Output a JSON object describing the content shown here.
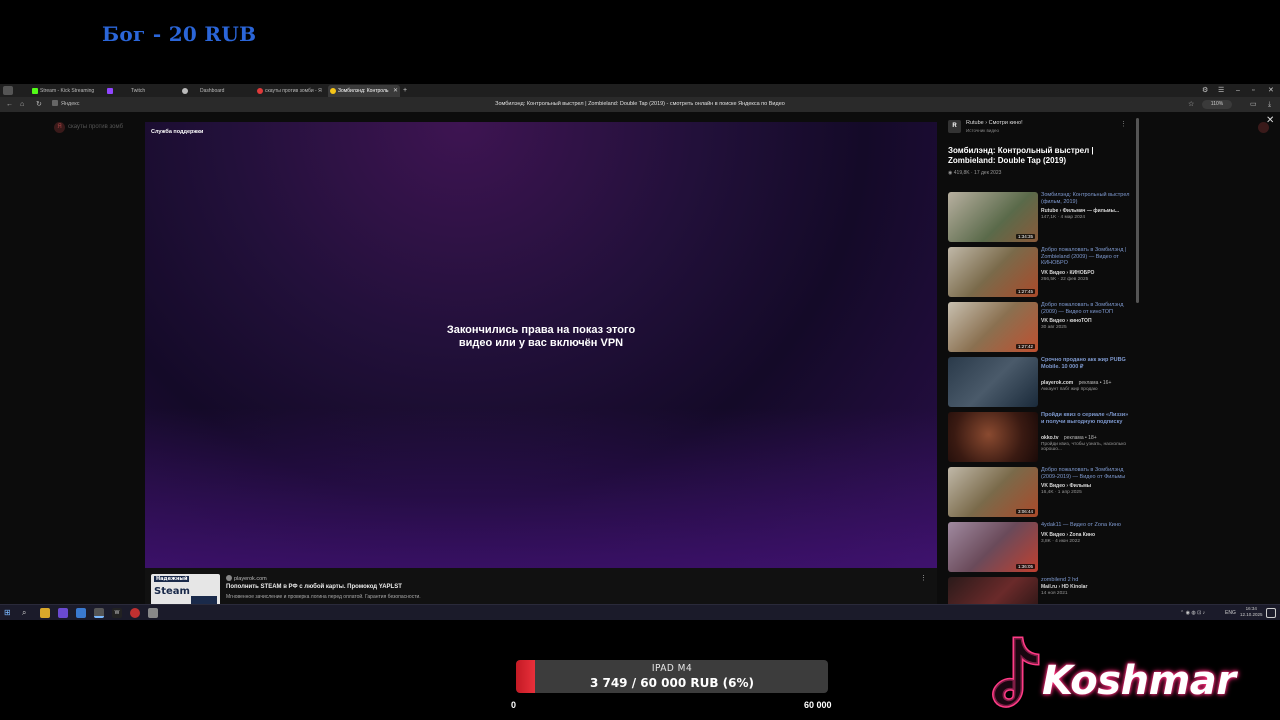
{
  "overlay": {
    "donor_label": "Бог - 20 RUB",
    "goal": {
      "name": "IPAD M4",
      "amount_text": "3 749 / 60 000 RUB (6%)",
      "current": 3749,
      "target": 60000,
      "progress": 0.06,
      "min_label": "0",
      "max_label": "60 000",
      "fill_color": "#e0232e"
    },
    "logo_text": "Koshmar"
  },
  "browser": {
    "tabs": [
      {
        "label": "Stream - Kick Streaming",
        "icon": "kick-icon",
        "color": "#53fc18",
        "active": false
      },
      {
        "label": "Twitch",
        "icon": "twitch-icon",
        "color": "#9146ff",
        "active": false
      },
      {
        "label": "Dashboard",
        "icon": "shield-icon",
        "color": "#bbbbbb",
        "active": false
      },
      {
        "label": "скауты против зомби - Я",
        "icon": "yandex-icon",
        "color": "#e03a3a",
        "active": false
      },
      {
        "label": "Зомбилэнд: Контроль",
        "icon": "yandex-video-icon",
        "color": "#f5c518",
        "active": true
      }
    ],
    "address_site": "Яндекс",
    "page_title": "Зомбилэнд: Контрольный выстрел | Zombieland: Double Tap (2019) - смотреть онлайн в поиске Яндекса по Видео",
    "zoom": "110%",
    "ghost_search": "скауты против зомб"
  },
  "player": {
    "support_label": "Служба поддержки",
    "message": "Закончились права на показ этого видео или у вас включён VPN"
  },
  "ad": {
    "thumb_line1": "Надежный",
    "thumb_line2": "Steam",
    "source": "playerok.com",
    "title": "Пополнить STEAM в РФ с любой карты. Промокод YAPLST",
    "subtitle": "Мгновенное зачисление и проверка логина перед оплатой. Гарантия безопасности."
  },
  "side": {
    "source_name": "Rutube › Смотри кино!",
    "source_sub": "Источник видео",
    "title": "Зомбилэнд: Контрольный выстрел | Zombieland: Double Tap (2019)",
    "meta": "419,8K · 17 дек 2023"
  },
  "related": [
    {
      "title": "Зомбилэнд: Контрольный выстрел (фильм, 2019)",
      "source": "Rutube › Фильмач — фильмы...",
      "meta": "147,1K · 4 мар 2024",
      "duration": "1:34:35",
      "thumb_color": "#7a8a6a"
    },
    {
      "title": "Добро пожаловать в Зомбилэнд | Zombieland (2009) — Видео от КИНОБРО",
      "source": "VK Видео › КИНОБРО",
      "meta": "266,5K · 22 фев 2025",
      "duration": "1:27:45",
      "thumb_color": "#8a7a5a"
    },
    {
      "title": "Добро пожаловать в Зомбилэнд (2009) — Видео от киноТОП",
      "source": "VK Видео › киноТОП",
      "meta": "30 авг 2025",
      "duration": "1:27:42",
      "thumb_color": "#9a8060"
    },
    {
      "title": "Срочно продано акк жир PUBG Mobile. 10 000 ₽",
      "source": "playerok.com",
      "meta": "Аккаунт пабг жир продаю",
      "duration": "",
      "thumb_color": "#3a4a5a",
      "badge": "реклама • 16+"
    },
    {
      "title": "Пройди квиз о сериале «Лиззи» и получи выгодную подписку",
      "source": "okko.tv",
      "meta": "Пройди квиз, чтобы узнать, насколько хорошо...",
      "duration": "",
      "thumb_color": "#4a2a20",
      "badge": "реклама • 18+"
    },
    {
      "title": "Добро пожаловать в Зомбилэнд (2009-2019) — Видео от Фильмы",
      "source": "VK Видео › Фильмы",
      "meta": "16,4K · 1 апр 2025",
      "duration": "3:06:44",
      "thumb_color": "#8a7a5a"
    },
    {
      "title": "4ydak11 — Видео от Zona Кино",
      "source": "VK Видео › Zona Кино",
      "meta": "3,8K · 4 июн 2022",
      "duration": "1:36:05",
      "thumb_color": "#6a5a6a"
    },
    {
      "title": "zombilend 2 hd",
      "source": "Mail.ru › HD Kinolar",
      "meta": "14 ноя 2021",
      "duration": "",
      "thumb_color": "#5a2a2a"
    }
  ],
  "taskbar": {
    "lang": "ENG",
    "time": "16:34",
    "date": "12.10.2025"
  }
}
